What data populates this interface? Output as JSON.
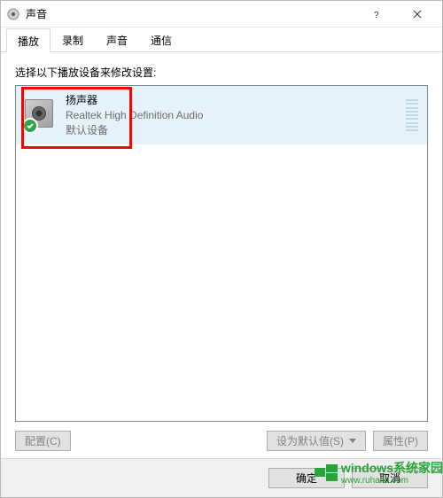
{
  "window": {
    "title": "声音"
  },
  "tabs": {
    "items": [
      {
        "label": "播放",
        "active": true
      },
      {
        "label": "录制",
        "active": false
      },
      {
        "label": "声音",
        "active": false
      },
      {
        "label": "通信",
        "active": false
      }
    ]
  },
  "content": {
    "instruction": "选择以下播放设备来修改设置:"
  },
  "device": {
    "name": "扬声器",
    "description": "Realtek High Definition Audio",
    "status": "默认设备"
  },
  "buttons": {
    "configure": "配置(C)",
    "set_default": "设为默认值(S)",
    "properties": "属性(P)",
    "ok": "确定",
    "cancel": "取消"
  },
  "watermark": {
    "brand": "windows",
    "subtitle": "系统家园",
    "url": "www.ruhaifu.com"
  }
}
